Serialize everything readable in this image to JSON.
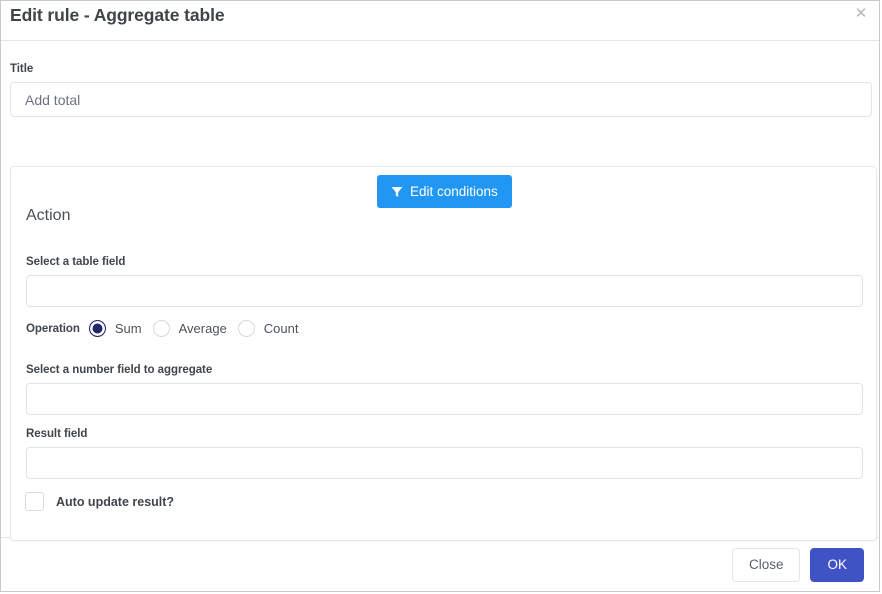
{
  "dialog": {
    "title": "Edit rule - Aggregate table",
    "close_icon": "close-icon",
    "close_glyph": "✕"
  },
  "title_field": {
    "label": "Title",
    "value": "Add total",
    "placeholder": "Add total"
  },
  "conditions": {
    "button_label": "Edit conditions",
    "icon": "filter-funnel-icon",
    "accent_color": "#2196f3"
  },
  "action": {
    "heading": "Action",
    "table_field": {
      "label": "Select a table field",
      "value": "",
      "placeholder": ""
    },
    "operation": {
      "label": "Operation",
      "selected": "Sum",
      "selected_color": "#22276b",
      "options": [
        {
          "label": "Sum",
          "checked": true
        },
        {
          "label": "Average",
          "checked": false
        },
        {
          "label": "Count",
          "checked": false
        }
      ]
    },
    "number_field": {
      "label": "Select a number field to aggregate",
      "value": "",
      "placeholder": ""
    },
    "result_field": {
      "label": "Result field",
      "value": "",
      "placeholder": ""
    },
    "auto_update": {
      "label": "Auto update result?",
      "checked": false
    }
  },
  "footer": {
    "close_label": "Close",
    "ok_label": "OK",
    "ok_color": "#4053c4"
  }
}
